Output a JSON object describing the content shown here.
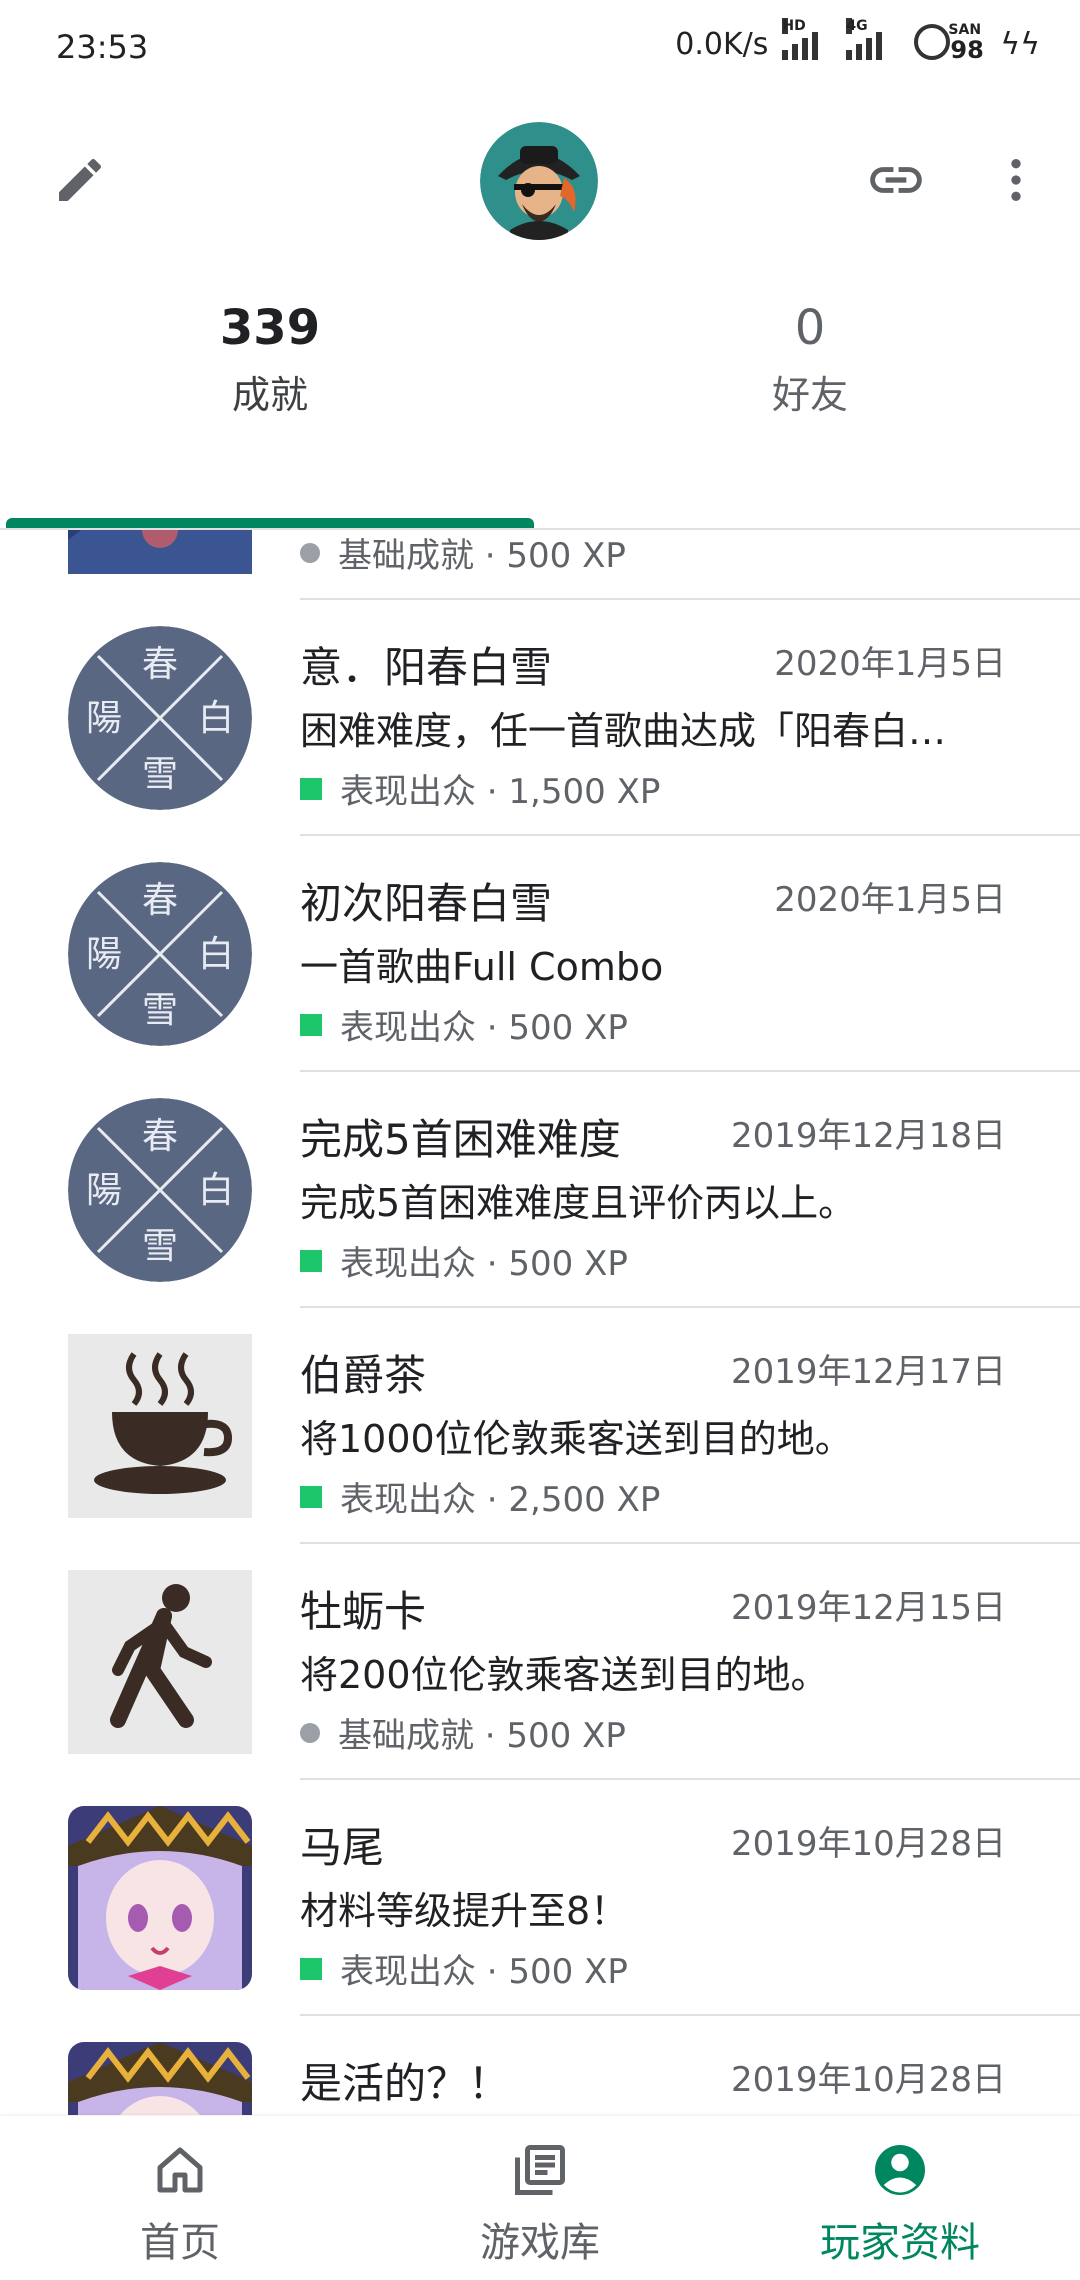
{
  "status_bar": {
    "time": "23:53",
    "speed": "0.0K/s",
    "net_hd": "HD",
    "net_4g": "4G",
    "battery_label": "SAN",
    "battery_value": "98"
  },
  "appbar": {
    "edit_icon": "pencil-icon",
    "link_icon": "link-icon",
    "more_icon": "more-vertical-icon"
  },
  "tabs": [
    {
      "count": "339",
      "label": "成就"
    },
    {
      "count": "0",
      "label": "好友"
    }
  ],
  "achievements": [
    {
      "title": "",
      "date": "",
      "desc": "",
      "meta": "基础成就 · 500 XP",
      "tier": "basic",
      "thumb": "mountain-landscape"
    },
    {
      "title": "意．阳春白雪",
      "date": "2020年1月5日",
      "desc": "困难难度，任一首歌曲达成「阳春白…",
      "meta": "表现出众 · 1,500 XP",
      "tier": "outstanding",
      "thumb": "yangchun-baixue-emblem"
    },
    {
      "title": "初次阳春白雪",
      "date": "2020年1月5日",
      "desc": "一首歌曲Full Combo",
      "meta": "表现出众 · 500 XP",
      "tier": "outstanding",
      "thumb": "yangchun-baixue-emblem"
    },
    {
      "title": "完成5首困难难度",
      "date": "2019年12月18日",
      "desc": "完成5首困难难度且评价丙以上。",
      "meta": "表现出众 · 500 XP",
      "tier": "outstanding",
      "thumb": "yangchun-baixue-emblem"
    },
    {
      "title": "伯爵茶",
      "date": "2019年12月17日",
      "desc": "将1000位伦敦乘客送到目的地。",
      "meta": "表现出众 · 2,500 XP",
      "tier": "outstanding",
      "thumb": "teacup-icon"
    },
    {
      "title": "牡蛎卡",
      "date": "2019年12月15日",
      "desc": "将200位伦敦乘客送到目的地。",
      "meta": "基础成就 · 500 XP",
      "tier": "basic",
      "thumb": "walking-person-icon"
    },
    {
      "title": "马尾",
      "date": "2019年10月28日",
      "desc": "材料等级提升至8！",
      "meta": "表现出众 · 500 XP",
      "tier": "outstanding",
      "thumb": "anime-witch-girl"
    },
    {
      "title": "是活的？！",
      "date": "2019年10月28日",
      "desc": "",
      "meta": "",
      "tier": "",
      "thumb": "anime-witch-girl"
    }
  ],
  "emblem_chars": [
    "春",
    "陽",
    "白",
    "雪"
  ],
  "bottom_nav": [
    {
      "label": "首页",
      "icon": "home-icon"
    },
    {
      "label": "游戏库",
      "icon": "library-icon"
    },
    {
      "label": "玩家资料",
      "icon": "account-circle-icon"
    }
  ],
  "colors": {
    "accent": "#01875f",
    "emblem_bg": "#5a6783",
    "outstanding": "#1ec66b",
    "basic": "#9aa0a6"
  }
}
